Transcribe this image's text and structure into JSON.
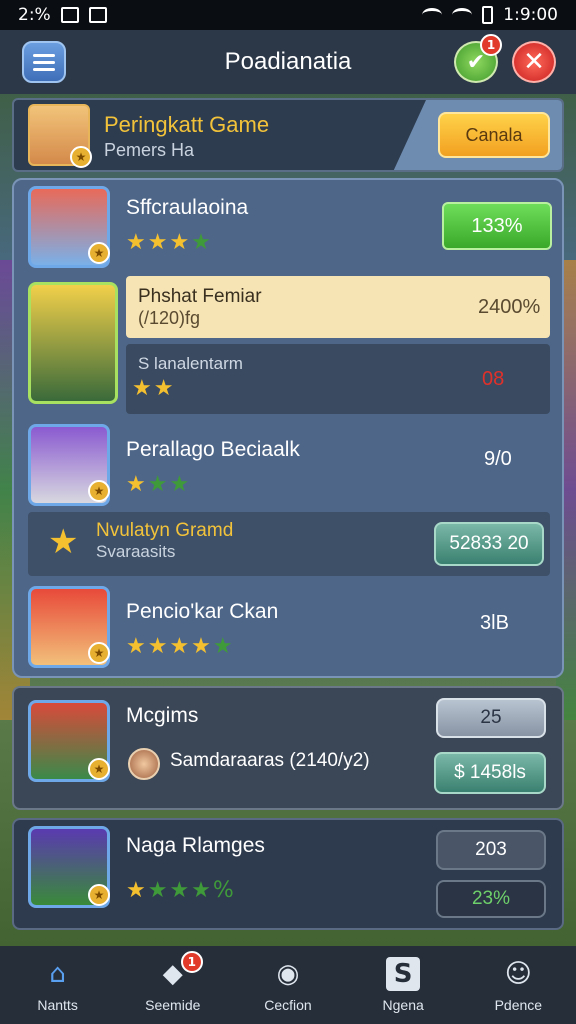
{
  "status_bar": {
    "left_text": "2:% ",
    "time": "1:9:00"
  },
  "header": {
    "title": "Poadianatia",
    "check_badge": "1"
  },
  "banner": {
    "title": "Peringkatt Game",
    "subtitle": "Pemers Ha",
    "button_label": "Canala"
  },
  "rows": [
    {
      "name": "Sffcraulaoina",
      "stars_on": 3,
      "stars_total": 4,
      "value": "133%",
      "value_style": "green"
    },
    {
      "name": "Phshat Femiar",
      "sub": "(/120)fg",
      "value": "2400%",
      "value_style": "highlight"
    },
    {
      "name": "S lanalentarm",
      "stars_on": 2,
      "value": "08",
      "value_color": "#e0302a"
    },
    {
      "name": "Perallago Beciaalk",
      "stars_on": 1,
      "stars_total": 3,
      "value": "9/0"
    },
    {
      "name": "Nvulatyn Gramd",
      "sub": "Svaraasits",
      "value": "52833 20",
      "value_style": "teal"
    },
    {
      "name": "Pencio'kar Ckan",
      "stars_on": 4,
      "stars_total": 5,
      "value": "3lB"
    }
  ],
  "panel2": {
    "name": "Mcgims",
    "sub": "Samdaraaras (2140/y2)",
    "value1": "25",
    "value2": "$ 1458ls"
  },
  "panel3": {
    "name": "Naga Rlamges",
    "stars_on": 1,
    "stars_total": 4,
    "star_suffix": "%",
    "value1": "203",
    "value2": "23%"
  },
  "tabs": [
    {
      "label": "Nantts",
      "icon": "home-icon",
      "glyph": "⌂"
    },
    {
      "label": "Seemide",
      "icon": "tag-icon",
      "glyph": "◆",
      "badge": "1"
    },
    {
      "label": "Cecfion",
      "icon": "circle-icon",
      "glyph": "◉"
    },
    {
      "label": "Ngena",
      "icon": "s-box-icon",
      "glyph": "S"
    },
    {
      "label": "Pdence",
      "icon": "user-icon",
      "glyph": "☺"
    }
  ],
  "colors": {
    "gold": "#f2c33a",
    "green": "#3aa82a",
    "red": "#e0302a",
    "panel": "#4e6688"
  }
}
